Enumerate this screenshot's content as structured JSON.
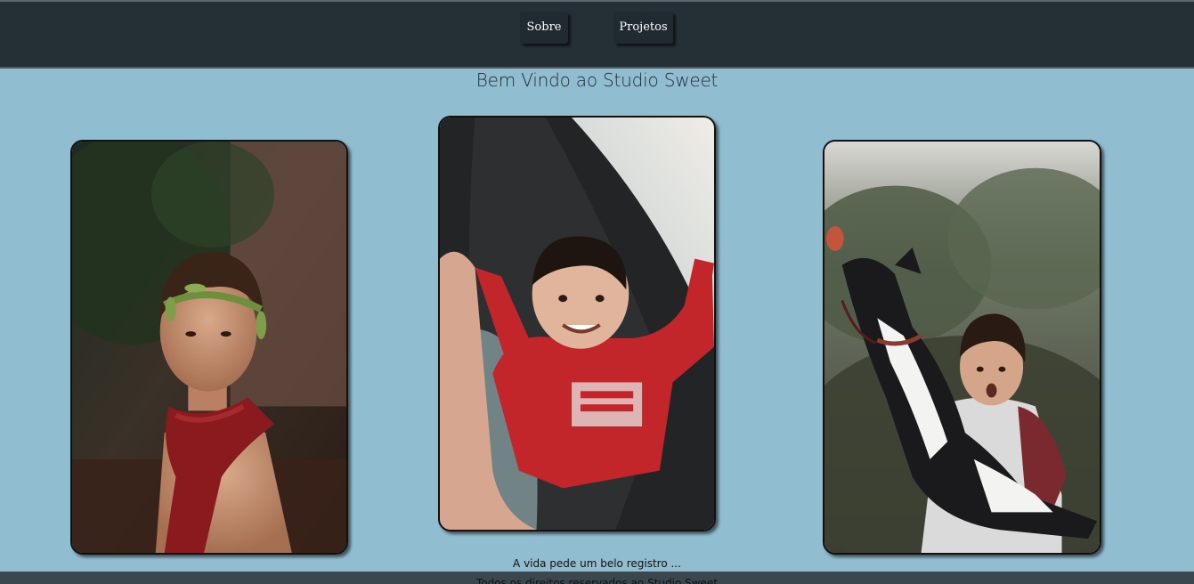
{
  "nav": {
    "sobre_label": "Sobre",
    "projetos_label": "Projetos"
  },
  "main": {
    "title": "Bem Vindo ao Studio Sweet",
    "tagline": "A vida pede um belo registro ..."
  },
  "footer": {
    "text": "Todos os direitos reservados ao Studio Sweet"
  },
  "colors": {
    "header_bg": "#252f36",
    "page_bg": "#91bdd0",
    "footer_bg": "#3b474f"
  }
}
